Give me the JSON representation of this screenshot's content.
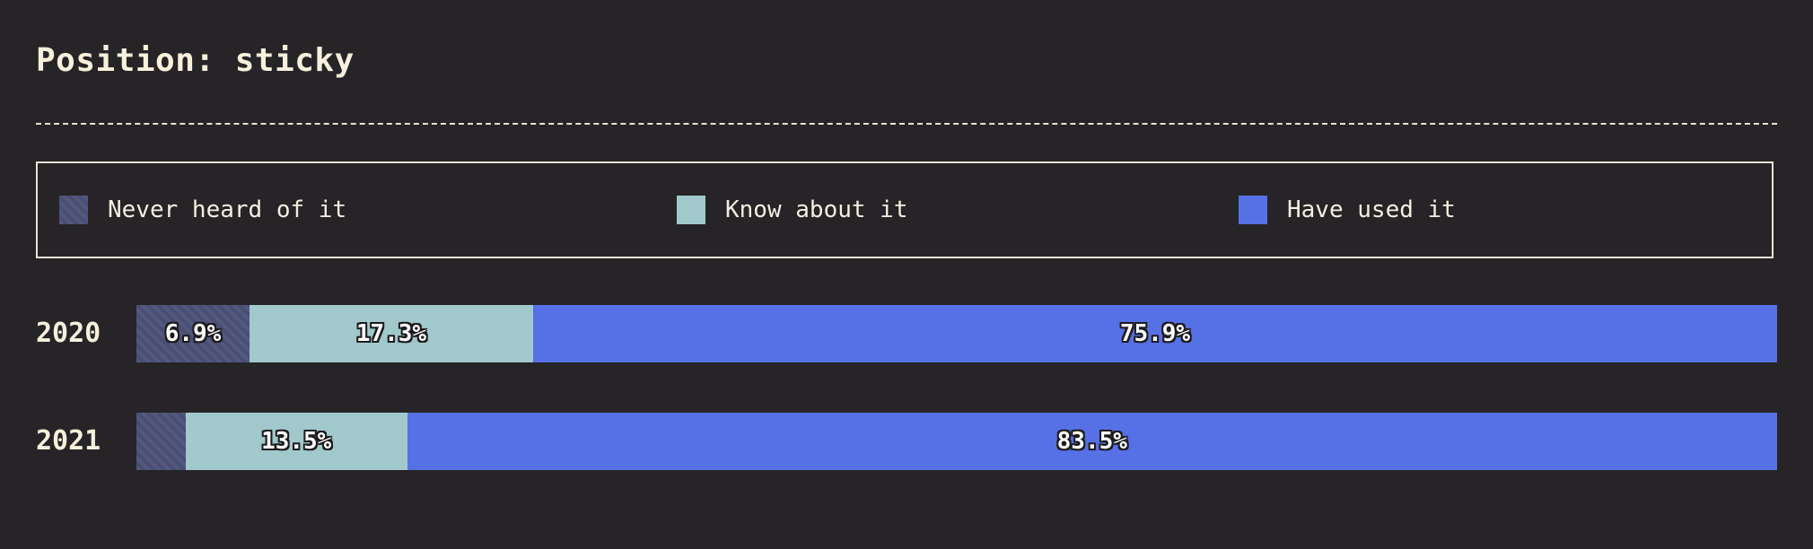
{
  "title": "Position: sticky",
  "legend": [
    {
      "label": "Never heard of it",
      "color": "#494e75"
    },
    {
      "label": "Know about it",
      "color": "#a1c9cc"
    },
    {
      "label": "Have used it",
      "color": "#5670e5"
    }
  ],
  "chart_data": {
    "type": "bar",
    "orientation": "horizontal",
    "stacked": true,
    "categories": [
      "2020",
      "2021"
    ],
    "series": [
      {
        "name": "Never heard of it",
        "values": [
          6.9,
          3.0
        ],
        "labels": [
          "6.9%",
          ""
        ]
      },
      {
        "name": "Know about it",
        "values": [
          17.3,
          13.5
        ],
        "labels": [
          "17.3%",
          "13.5%"
        ]
      },
      {
        "name": "Have used it",
        "values": [
          75.9,
          83.5
        ],
        "labels": [
          "75.9%",
          "83.5%"
        ]
      }
    ],
    "xlim": [
      0,
      100
    ],
    "grid": false,
    "legend_position": "top"
  }
}
